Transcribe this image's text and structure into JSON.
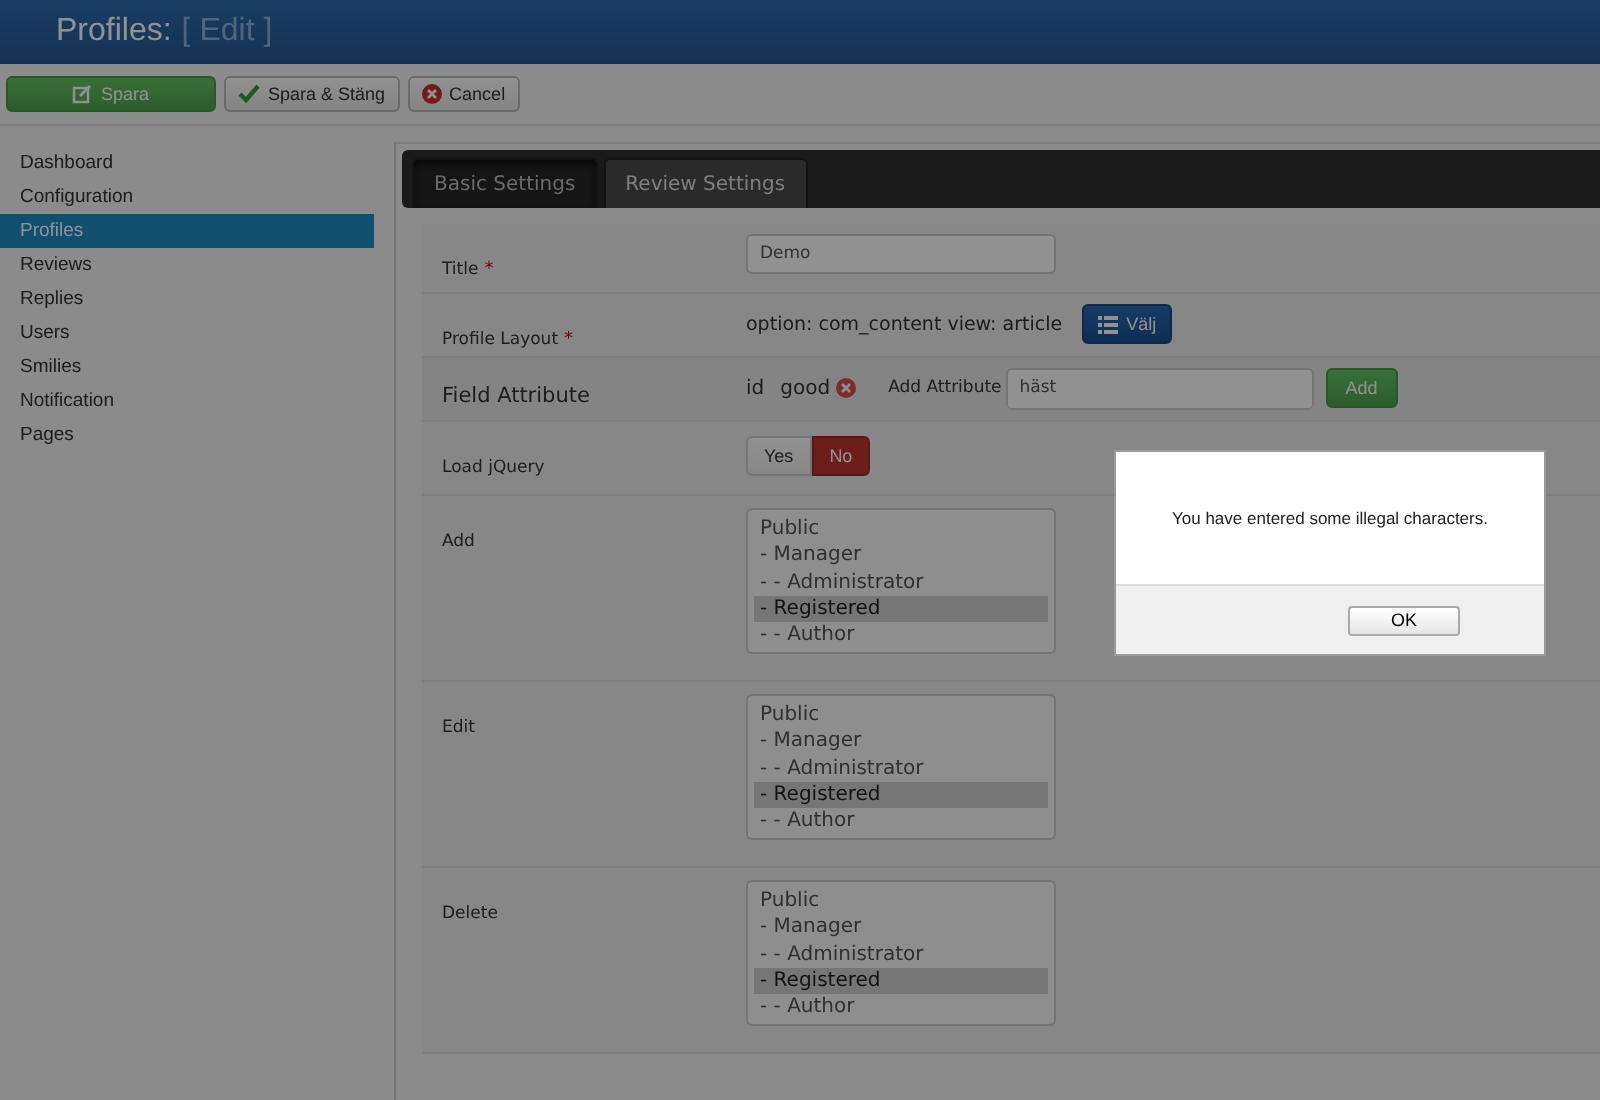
{
  "header": {
    "title": "Profiles:",
    "subtitle": "[ Edit ]"
  },
  "toolbar": [
    {
      "label": "Spara",
      "kind": "save"
    },
    {
      "label": "Spara & Stäng",
      "kind": "check"
    },
    {
      "label": "Cancel",
      "kind": "cancel"
    }
  ],
  "sidebar": {
    "items": [
      {
        "label": "Dashboard",
        "selected": false
      },
      {
        "label": "Configuration",
        "selected": false
      },
      {
        "label": "Profiles",
        "selected": true
      },
      {
        "label": "Reviews",
        "selected": false
      },
      {
        "label": "Replies",
        "selected": false
      },
      {
        "label": "Users",
        "selected": false
      },
      {
        "label": "Smilies",
        "selected": false
      },
      {
        "label": "Notification",
        "selected": false
      },
      {
        "label": "Pages",
        "selected": false
      }
    ]
  },
  "tabs": [
    {
      "label": "Basic Settings",
      "selected": true
    },
    {
      "label": "Review Settings",
      "selected": false
    }
  ],
  "form": [
    {
      "kind": "text",
      "label": "Title",
      "required_mark": "*",
      "value": "Demo"
    },
    {
      "kind": "layout",
      "label": "Profile Layout",
      "required_mark": "*",
      "text": "option: com_content view: article",
      "button": "Välj"
    },
    {
      "kind": "attributes",
      "label": "Field Attribute",
      "tags": [
        {
          "label": "id",
          "removable": false
        },
        {
          "label": "good",
          "removable": true
        }
      ],
      "add_label": "Add Attribute",
      "value": "häst",
      "button": "Add"
    },
    {
      "kind": "toggle",
      "label": "Load jQuery",
      "options": [
        {
          "label": "Yes",
          "selected": false
        },
        {
          "label": "No",
          "selected": true
        }
      ]
    },
    {
      "kind": "list",
      "label": "Add",
      "options": [
        {
          "label": "Public",
          "selected": false
        },
        {
          "label": "- Manager",
          "selected": false
        },
        {
          "label": "- - Administrator",
          "selected": false
        },
        {
          "label": "- Registered",
          "selected": true
        },
        {
          "label": "- - Author",
          "selected": false
        }
      ]
    },
    {
      "kind": "list",
      "label": "Edit",
      "options": [
        {
          "label": "Public",
          "selected": false
        },
        {
          "label": "- Manager",
          "selected": false
        },
        {
          "label": "- - Administrator",
          "selected": false
        },
        {
          "label": "- Registered",
          "selected": true
        },
        {
          "label": "- - Author",
          "selected": false
        }
      ]
    },
    {
      "kind": "list",
      "label": "Delete",
      "options": [
        {
          "label": "Public",
          "selected": false
        },
        {
          "label": "- Manager",
          "selected": false
        },
        {
          "label": "- - Administrator",
          "selected": false
        },
        {
          "label": "- Registered",
          "selected": true
        },
        {
          "label": "- - Author",
          "selected": false
        }
      ]
    }
  ],
  "dialog": {
    "message": "You have entered some illegal characters.",
    "button": "OK"
  }
}
